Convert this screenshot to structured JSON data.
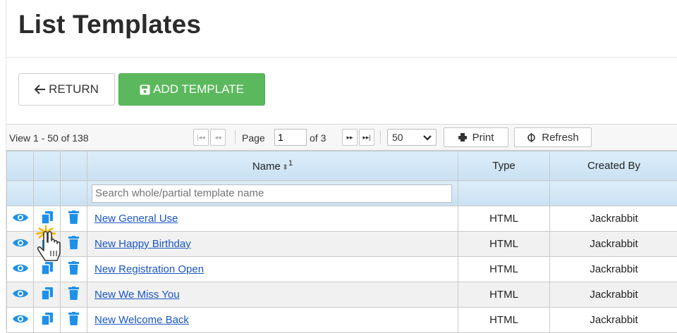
{
  "page": {
    "title": "List Templates"
  },
  "actions": {
    "return_label": "RETURN",
    "add_label": "ADD TEMPLATE"
  },
  "pager": {
    "view_text": "View 1 - 50 of 138",
    "page_label": "Page",
    "page_value": "1",
    "of_text": "of 3",
    "page_size": "50",
    "print_label": "Print",
    "refresh_label": "Refresh"
  },
  "table": {
    "columns": {
      "name": "Name",
      "name_sort_rank": "1",
      "type": "Type",
      "created_by": "Created By"
    },
    "search_placeholder": "Search whole/partial template name",
    "rows": [
      {
        "name": "New General Use",
        "type": "HTML",
        "created_by": "Jackrabbit"
      },
      {
        "name": "New Happy Birthday",
        "type": "HTML",
        "created_by": "Jackrabbit"
      },
      {
        "name": "New Registration Open",
        "type": "HTML",
        "created_by": "Jackrabbit"
      },
      {
        "name": "New We Miss You",
        "type": "HTML",
        "created_by": "Jackrabbit"
      },
      {
        "name": "New Welcome Back",
        "type": "HTML",
        "created_by": "Jackrabbit"
      }
    ]
  },
  "icons": {
    "return": "arrow-left-icon",
    "add": "floppy-disk-icon",
    "view": "eye-icon",
    "copy": "copy-icon",
    "delete": "trash-icon",
    "print": "printer-icon",
    "refresh": "refresh-icon",
    "sort": "sort-icon",
    "cursor": "hand-pointer-icon"
  },
  "colors": {
    "accent_green": "#5cb85c",
    "icon_blue": "#1e90e8",
    "link_blue": "#1a56c4",
    "header_blue": "#c9e1f3"
  }
}
